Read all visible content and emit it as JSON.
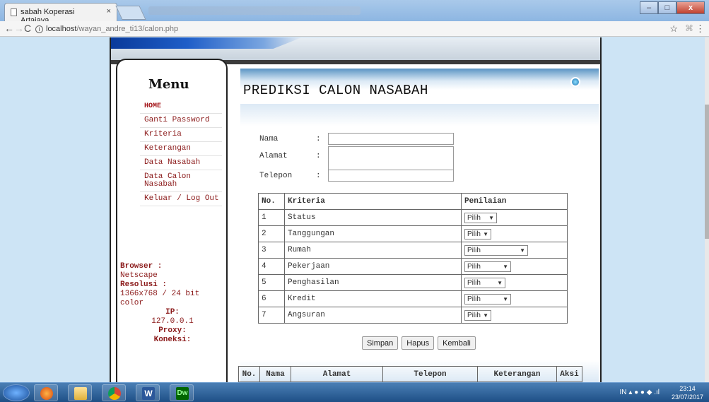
{
  "browser": {
    "tab_title": "sabah Koperasi Artajaya...",
    "tab_close": "×",
    "url_host": "localhost",
    "url_path": "/wayan_andre_ti13/calon.php",
    "star": "☆",
    "menu": "⋮"
  },
  "menu": {
    "title": "Menu",
    "items": [
      {
        "label": "HOME"
      },
      {
        "label": "Ganti Password"
      },
      {
        "label": "Kriteria"
      },
      {
        "label": "Keterangan"
      },
      {
        "label": "Data Nasabah"
      },
      {
        "label": "Data Calon Nasabah"
      },
      {
        "label": "Keluar / Log Out"
      }
    ]
  },
  "info": {
    "browser_label": "Browser :",
    "browser_value": "Netscape",
    "resolution_label": "Resolusi :",
    "resolution_value": "1366x768 / 24 bit color",
    "ip_label": "IP:",
    "ip_value": "127.0.0.1",
    "proxy_label": "Proxy:",
    "connection_label": "Koneksi:"
  },
  "page": {
    "title": "PREDIKSI CALON NASABAH"
  },
  "form": {
    "nama_label": "Nama",
    "alamat_label": "Alamat",
    "telepon_label": "Telepon",
    "colon": ":"
  },
  "criteria_table": {
    "headers": {
      "no": "No.",
      "kriteria": "Kriteria",
      "penilaian": "Penilaian"
    },
    "rows": [
      {
        "no": "1",
        "kriteria": "Status",
        "select": "Pilih"
      },
      {
        "no": "2",
        "kriteria": "Tanggungan",
        "select": "Pilih"
      },
      {
        "no": "3",
        "kriteria": "Rumah",
        "select": "Pilih"
      },
      {
        "no": "4",
        "kriteria": "Pekerjaan",
        "select": "Pilih"
      },
      {
        "no": "5",
        "kriteria": "Penghasilan",
        "select": "Pilih"
      },
      {
        "no": "6",
        "kriteria": "Kredit",
        "select": "Pilih"
      },
      {
        "no": "7",
        "kriteria": "Angsuran",
        "select": "Pilih"
      }
    ]
  },
  "buttons": {
    "save": "Simpan",
    "delete": "Hapus",
    "back": "Kembali"
  },
  "data_table": {
    "headers": [
      "No.",
      "Nama",
      "Alamat",
      "Telepon",
      "Keterangan",
      "Aksi"
    ]
  },
  "taskbar": {
    "lang": "IN",
    "time": "23:14",
    "date": "23/07/2017"
  }
}
